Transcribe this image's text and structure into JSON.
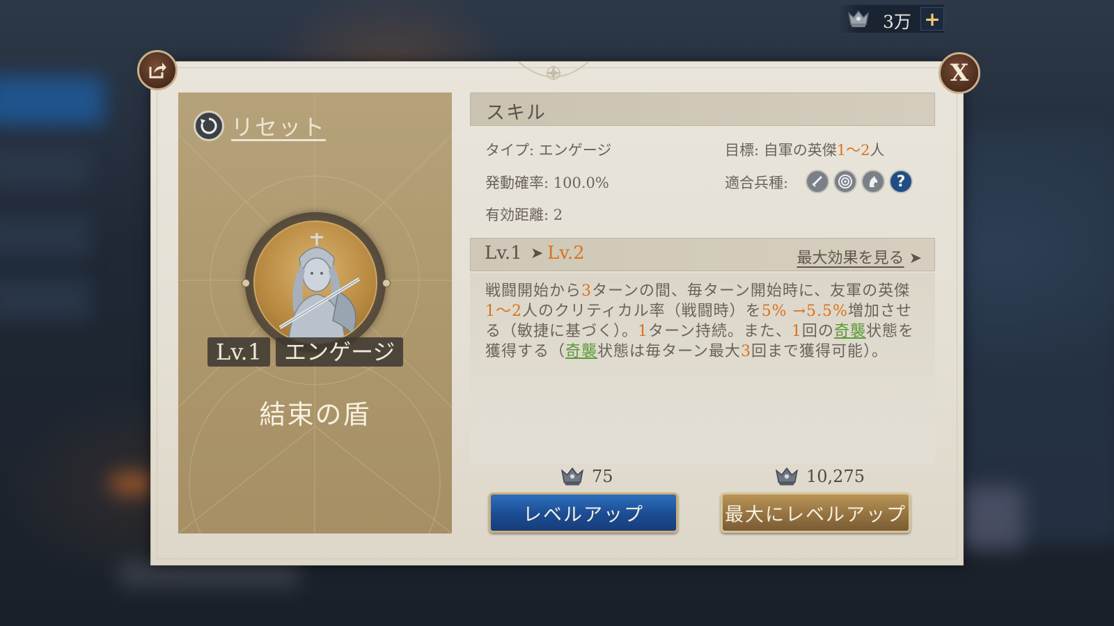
{
  "currency": {
    "amount": "3万",
    "plus": "+"
  },
  "dialog": {
    "close_label": "X"
  },
  "left": {
    "reset_label": "リセット",
    "level_tag": "Lv.1",
    "type_tag": "エンゲージ",
    "skill_name": "結束の盾"
  },
  "skill": {
    "header": "スキル",
    "type_label": "タイプ: ",
    "type_value": "エンゲージ",
    "target_label": "目標: ",
    "target_prefix": "自軍の英傑",
    "target_count": "1～2",
    "target_suffix": "人",
    "rate_label": "発動確率: ",
    "rate_value": "100.0%",
    "units_label": "適合兵種: ",
    "unit_icons": [
      "sword-icon",
      "bow-target-icon",
      "cavalry-icon",
      "question-icon"
    ],
    "unit_question": "?",
    "range_label": "有効距離: ",
    "range_value": "2"
  },
  "level": {
    "from": "Lv.1",
    "arrow": "➤",
    "to": "Lv.2",
    "max_effect": "最大効果を見る",
    "max_arrow": "➤"
  },
  "description": {
    "p1": "戦闘開始から",
    "n1": "3",
    "p2": "ターンの間、毎ターン開始時に、友軍の英傑",
    "n2": "1～2",
    "p3": "人のクリティカル率（戦闘時）を",
    "n3": "5% →5.5%",
    "p4": "増加させる（敏捷に基づく）。",
    "n4": "1",
    "p5": "ターン持続。また、",
    "n5": "1",
    "p6": "回の",
    "k1": "奇襲",
    "p7": "状態を獲得する（",
    "k2": "奇襲",
    "p8": "状態は毎ターン最大",
    "n6": "3",
    "p9": "回まで獲得可能）。"
  },
  "actions": {
    "levelup_cost": "75",
    "levelup_label": "レベルアップ",
    "maxlevel_cost": "10,275",
    "maxlevel_label": "最大にレベルアップ"
  },
  "colors": {
    "accent_orange": "#d8731f",
    "keyword_green": "#5b9a3a",
    "button_blue": "#1b4c93",
    "button_gold": "#957341"
  }
}
